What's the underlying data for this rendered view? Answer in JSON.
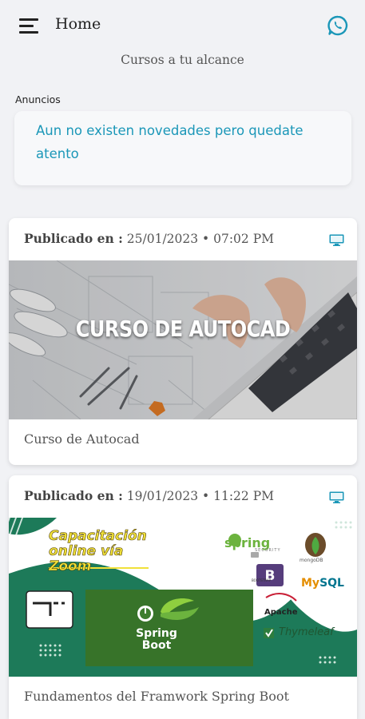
{
  "header": {
    "title": "Home",
    "subtitle": "Cursos a tu alcance",
    "menu_icon": "hamburger-menu-icon",
    "action_icon": "whatsapp-icon"
  },
  "announcements": {
    "label": "Anuncios",
    "message": "Aun no existen novedades pero quedate atento"
  },
  "courses": [
    {
      "published_label": "Publicado en :",
      "published_value": " 25/01/2023 • 07:02 PM",
      "thumbnail_text": "CURSO DE AUTOCAD",
      "name": "Curso de Autocad",
      "icon": "desktop-icon"
    },
    {
      "published_label": "Publicado en :",
      "published_value": " 19/01/2023 • 11:22 PM",
      "thumbnail": {
        "headline": [
          "Capacitación",
          "online vía",
          "Zoom"
        ],
        "center_logo": [
          "Spring",
          "Boot"
        ],
        "logos": {
          "spring_security": "spring",
          "spring_security_sub": "SECURITY",
          "mongodb": "mongoDB",
          "bootstrap": "B",
          "bootstrap_sub": "BOOTSTRAP",
          "mysql_a": "My",
          "mysql_b": "SQL",
          "apache": "Apache",
          "thymeleaf": "Thymeleaf"
        }
      },
      "name": "Fundamentos del Framwork Spring Boot",
      "icon": "desktop-icon"
    }
  ],
  "colors": {
    "accent": "#1b97b8",
    "background": "#f1f2f5",
    "brand_green": "#6cb33e"
  }
}
